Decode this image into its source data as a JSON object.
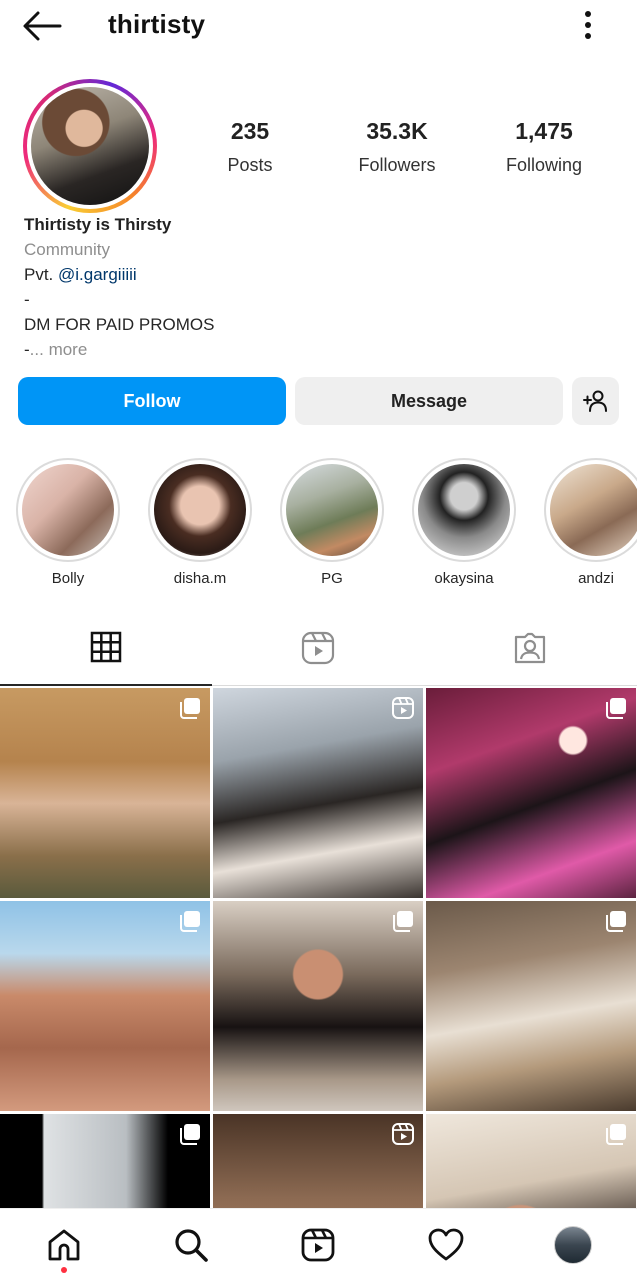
{
  "header": {
    "username": "thirtisty",
    "back_icon": "arrow-left-icon",
    "menu_icon": "more-vertical-icon"
  },
  "profile": {
    "stats": [
      {
        "value": "235",
        "label": "Posts"
      },
      {
        "value": "35.3K",
        "label": "Followers"
      },
      {
        "value": "1,475",
        "label": "Following"
      }
    ],
    "bio": {
      "name": "Thirtisty is Thirsty",
      "category": "Community",
      "line1_prefix": "Pvt. ",
      "mention": "@i.gargiiiii",
      "line2": "-",
      "line3": "DM FOR PAID PROMOS",
      "line4_prefix": "-",
      "more": "... more"
    }
  },
  "actions": {
    "follow": "Follow",
    "message": "Message",
    "add_user_icon": "person-add-icon"
  },
  "highlights": [
    {
      "label": "Bolly"
    },
    {
      "label": "disha.m"
    },
    {
      "label": "PG"
    },
    {
      "label": "okaysina"
    },
    {
      "label": "andzi"
    }
  ],
  "tabs": [
    {
      "icon": "grid-icon",
      "active": true
    },
    {
      "icon": "reels-icon",
      "active": false
    },
    {
      "icon": "tagged-icon",
      "active": false
    }
  ],
  "posts": [
    {
      "type": "carousel"
    },
    {
      "type": "reel"
    },
    {
      "type": "carousel"
    },
    {
      "type": "carousel"
    },
    {
      "type": "carousel"
    },
    {
      "type": "carousel"
    },
    {
      "type": "carousel"
    },
    {
      "type": "reel"
    },
    {
      "type": "carousel"
    }
  ],
  "bottom_nav": [
    {
      "icon": "home-icon",
      "active": true
    },
    {
      "icon": "search-icon"
    },
    {
      "icon": "reels-icon"
    },
    {
      "icon": "heart-icon"
    },
    {
      "icon": "profile-avatar"
    }
  ],
  "colors": {
    "follow_button": "#0095f6",
    "secondary_button": "#efefef",
    "mention": "#00376b",
    "muted_text": "#8e8e8e",
    "notification_dot": "#ff3040"
  }
}
